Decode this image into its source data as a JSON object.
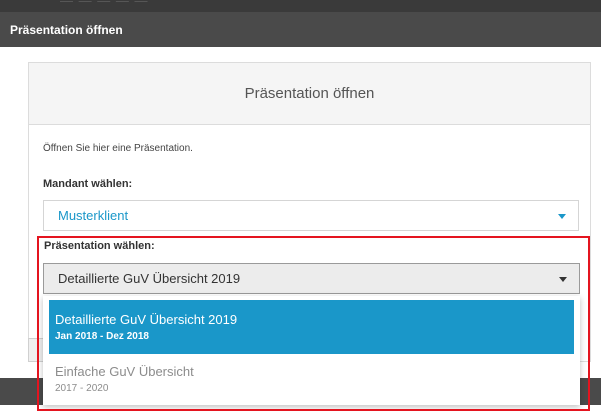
{
  "window": {
    "title": "Präsentation öffnen"
  },
  "dialog": {
    "header": "Präsentation öffnen",
    "intro": "Öffnen Sie hier eine Präsentation.",
    "mandant": {
      "label": "Mandant wählen:",
      "value": "Musterklient"
    },
    "presentation": {
      "label": "Präsentation wählen:",
      "value": "Detaillierte GuV Übersicht 2019",
      "options": [
        {
          "title": "Detaillierte GuV Übersicht 2019",
          "subtitle": "Jan 2018 - Dez 2018",
          "selected": true
        },
        {
          "title": "Einfache GuV Übersicht",
          "subtitle": "2017 - 2020",
          "selected": false
        }
      ]
    }
  },
  "colors": {
    "accent": "#1a97c9",
    "titlebar": "#4a4a4a",
    "highlight": "#e4141f"
  }
}
